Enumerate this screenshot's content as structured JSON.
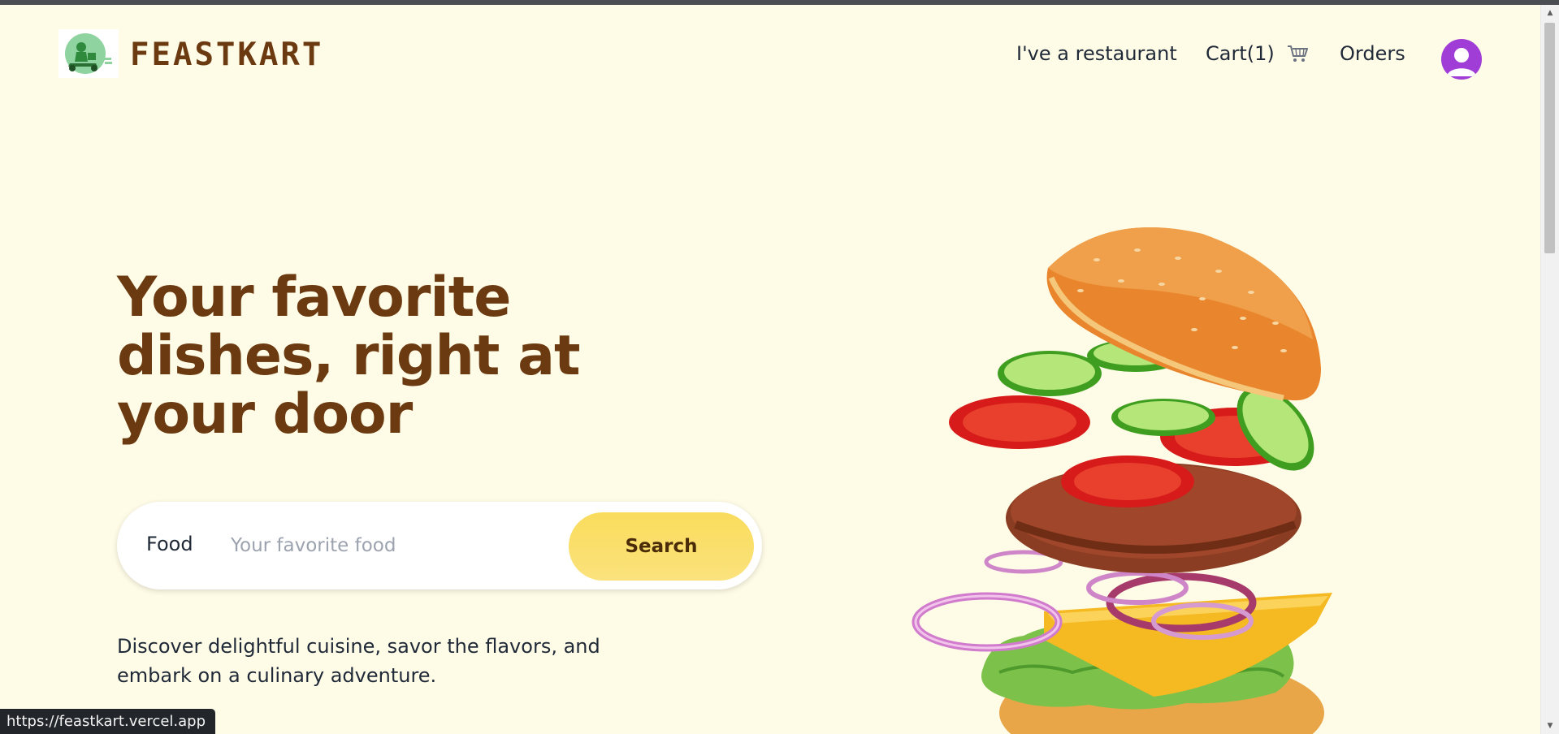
{
  "header": {
    "brand_name": "FEASTKART",
    "nav": {
      "restaurant_label": "I've a restaurant",
      "cart_label": "Cart(1)",
      "orders_label": "Orders"
    }
  },
  "hero": {
    "title": "Your favorite dishes, right at your door",
    "search": {
      "label": "Food",
      "placeholder": "Your favorite food",
      "value": "",
      "button_label": "Search"
    },
    "description": "Discover delightful cuisine, savor the flavors, and embark on a culinary adventure."
  },
  "status_bar": {
    "url": "https://feastkart.vercel.app"
  },
  "colors": {
    "page_background": "#fefbe6",
    "brand_brown": "#6b3a10",
    "search_button": "#f9dc5c",
    "avatar": "#a03dd6"
  },
  "icons": {
    "cart": "shopping-cart-icon",
    "avatar": "user-avatar-icon"
  }
}
